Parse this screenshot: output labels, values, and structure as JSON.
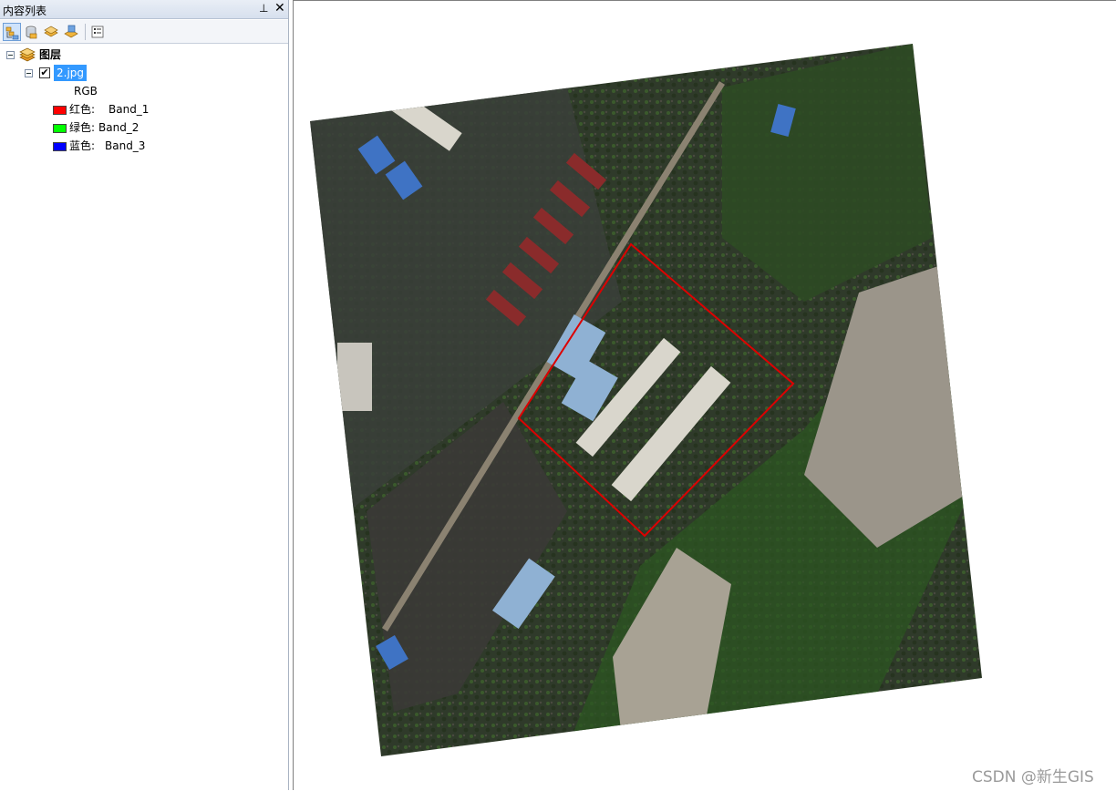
{
  "toc": {
    "title": "内容列表",
    "pin_glyph": "⊥",
    "close_glyph": "✕",
    "toolbar": [
      {
        "name": "list-by-drawing-order",
        "icon": "drawing-order-icon",
        "active": true
      },
      {
        "name": "list-by-source",
        "icon": "source-icon",
        "active": false
      },
      {
        "name": "list-by-visibility",
        "icon": "visibility-icon",
        "active": false
      },
      {
        "name": "list-by-selection",
        "icon": "selection-icon",
        "active": false
      },
      {
        "name": "options",
        "icon": "options-icon",
        "active": false
      }
    ],
    "root_label": "图层",
    "layer": {
      "name": "2.jpg",
      "checked": true,
      "check_glyph": "✔",
      "render_type": "RGB",
      "bands": [
        {
          "channel": "红色:",
          "band": "Band_1",
          "color": "#ff0000"
        },
        {
          "channel": "绿色:",
          "band": "Band_2",
          "color": "#00ff00"
        },
        {
          "channel": "蓝色:",
          "band": "Band_3",
          "color": "#0000ff"
        }
      ]
    }
  },
  "map": {
    "image_layer": "2.jpg",
    "selection_color": "#dd0000"
  },
  "watermark": "CSDN @新生GIS"
}
